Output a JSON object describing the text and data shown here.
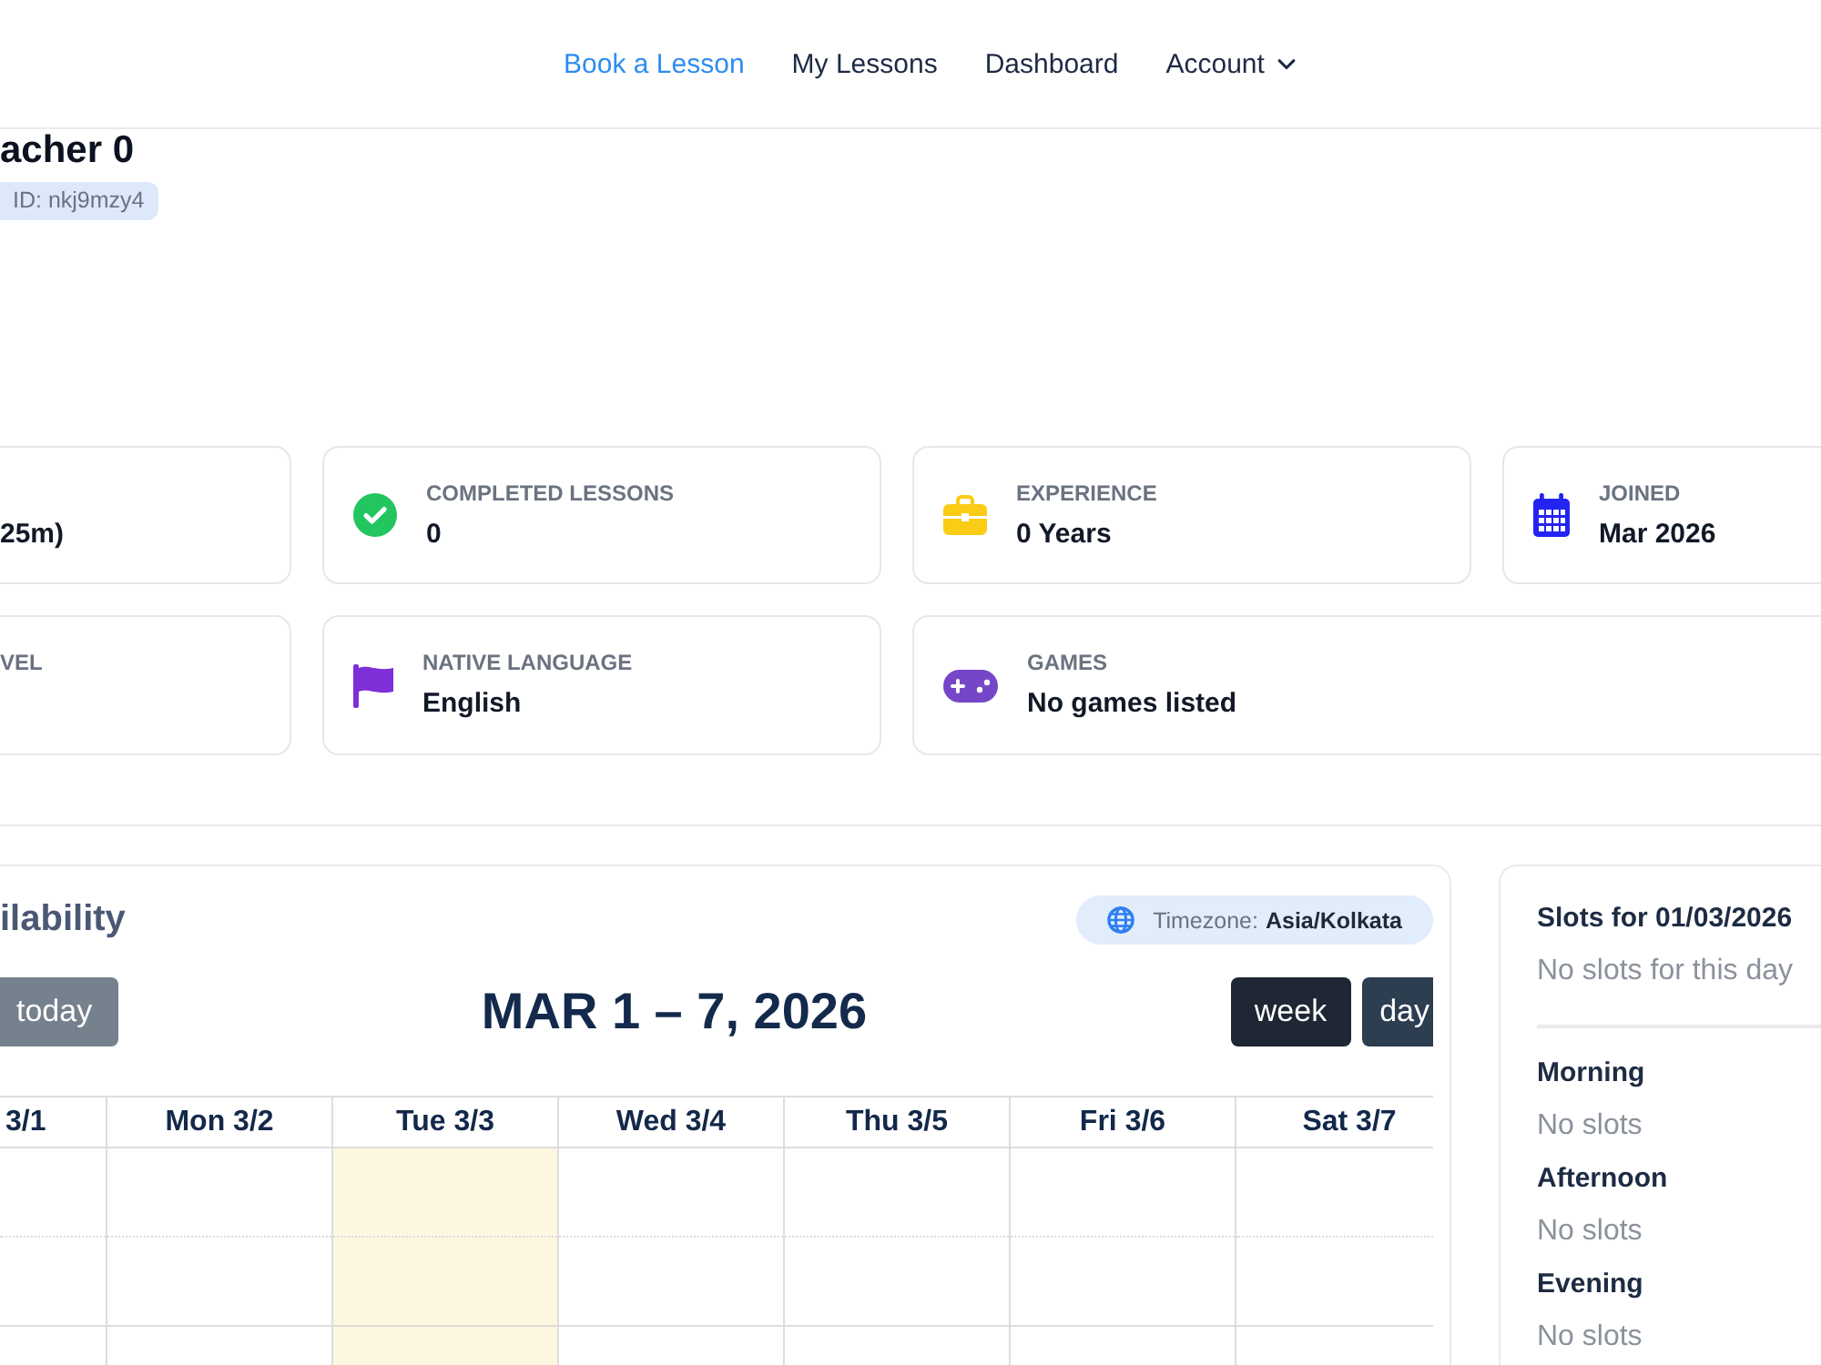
{
  "nav": {
    "links": [
      {
        "label": "Book a Lesson",
        "kind": "link",
        "selected": true
      },
      {
        "label": "My Lessons",
        "kind": "link",
        "selected": false
      },
      {
        "label": "Dashboard",
        "kind": "link",
        "selected": false
      },
      {
        "label": "Account",
        "kind": "menu",
        "selected": false
      }
    ]
  },
  "profile": {
    "name": "acher 0",
    "id_badge": "ID: nkj9mzy4"
  },
  "stats": [
    [
      {
        "kind": "clipped",
        "value": "25m)"
      },
      {
        "kind": "completed",
        "label": "COMPLETED LESSONS",
        "value": "0"
      },
      {
        "kind": "experience",
        "label": "EXPERIENCE",
        "value": "0 Years"
      },
      {
        "kind": "joined",
        "label": "JOINED",
        "value": "Mar 2026"
      }
    ],
    [
      {
        "kind": "clipped",
        "label": "VEL"
      },
      {
        "kind": "language",
        "label": "NATIVE LANGUAGE",
        "value": "English"
      },
      {
        "kind": "games",
        "label": "GAMES",
        "value": "No games listed"
      }
    ]
  ],
  "calendar": {
    "title": "ilability",
    "timezone": {
      "label": "Timezone:",
      "value": "Asia/Kolkata"
    },
    "today_button": {
      "label": "today",
      "disabled": true
    },
    "range_title": "MAR 1 – 7, 2026",
    "views": [
      {
        "label": "week",
        "selected": true
      },
      {
        "label": "day",
        "selected": false
      }
    ],
    "days": [
      {
        "label": "3/1",
        "today": false
      },
      {
        "label": "Mon 3/2",
        "today": false
      },
      {
        "label": "Tue 3/3",
        "today": true
      },
      {
        "label": "Wed 3/4",
        "today": false
      },
      {
        "label": "Thu 3/5",
        "today": false
      },
      {
        "label": "Fri 3/6",
        "today": false
      },
      {
        "label": "Sat 3/7",
        "today": false
      }
    ]
  },
  "slots": {
    "title": "Slots for 01/03/2026",
    "empty": "No slots for this day",
    "periods": [
      {
        "name": "Morning",
        "empty": "No slots"
      },
      {
        "name": "Afternoon",
        "empty": "No slots"
      },
      {
        "name": "Evening",
        "empty": "No slots"
      }
    ]
  }
}
